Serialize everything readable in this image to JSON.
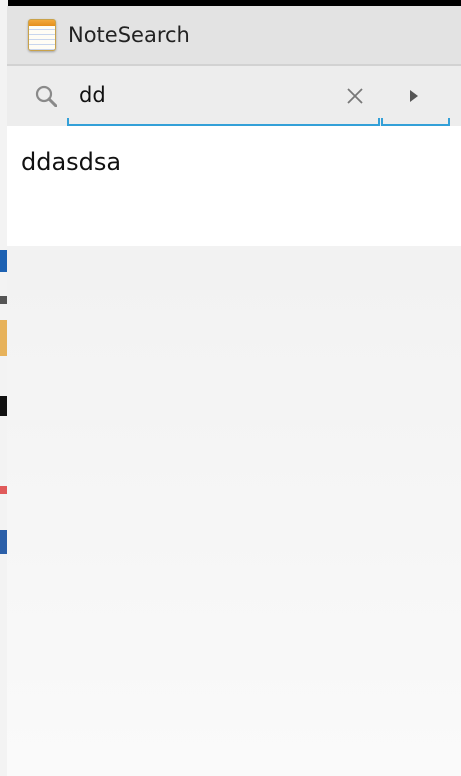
{
  "app": {
    "title": "NoteSearch",
    "icon": "notepad-icon"
  },
  "search": {
    "query": "dd",
    "search_icon": "search-icon",
    "clear_icon": "close-icon",
    "go_icon": "triangle-right-icon"
  },
  "results": [
    {
      "title": "ddasdsa"
    }
  ],
  "colors": {
    "accent": "#33a0d8",
    "title_bar": "#e3e3e3",
    "search_bar": "#ededed",
    "list_bg": "#ffffff"
  }
}
